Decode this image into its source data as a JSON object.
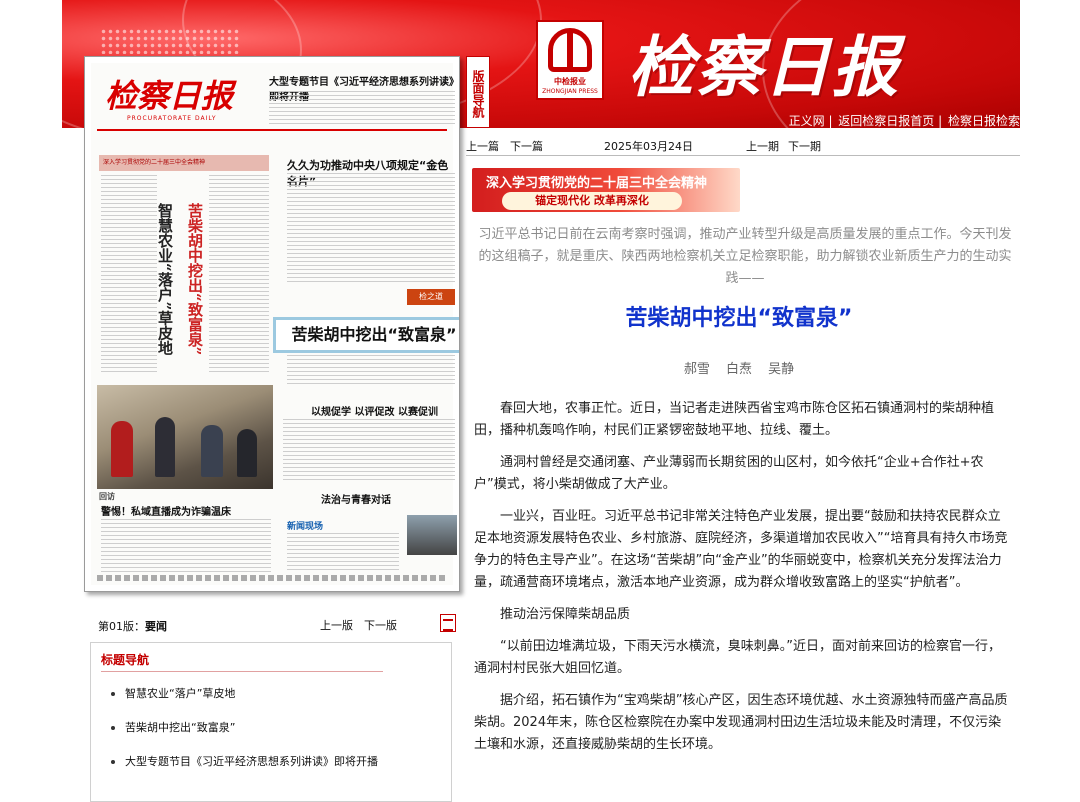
{
  "header": {
    "masthead": "检察日报",
    "logo_caption": "中检报业",
    "logo_caption_en": "ZHONGJIAN PRESS",
    "links": [
      "正义网",
      "返回检察日报首页",
      "检察日报检索"
    ]
  },
  "side_tab": "版面导航",
  "thumbnail": {
    "masthead": "检察日报",
    "subtitle": "PROCURATORATE DAILY",
    "top_headline": "大型专题节目《习近平经济思想系列讲读》即将开播",
    "banner": "深入学习贯彻党的二十届三中全会精神",
    "headline_right": "久久为功推动中央八项规定“金色名片”",
    "vertical_1": "苦柴胡中挖出“致富泉”",
    "vertical_2": "智慧农业“落户”草皮地",
    "highlight": "苦柴胡中挖出“致富泉”",
    "seal": "检之道",
    "h_mid": "以规促学 以评促改 以赛促训",
    "h_left": "警惕！私域直播成为诈骗温床",
    "h_right": "法治与青春对话",
    "h_news": "新闻现场",
    "caption": "回访"
  },
  "nav": {
    "prev_article": "上一篇",
    "next_article": "下一篇",
    "date": "2025年03月24日",
    "prev_issue": "上一期",
    "next_issue": "下一期"
  },
  "promo": {
    "line1": "深入学习贯彻党的二十届三中全会精神",
    "line2": "锚定现代化 改革再深化"
  },
  "article": {
    "lead": "习近平总书记日前在云南考察时强调，推动产业转型升级是高质量发展的重点工作。今天刊发的这组稿子，就是重庆、陕西两地检察机关立足检察职能，助力解锁农业新质生产力的生动实践——",
    "title": "苦柴胡中挖出“致富泉”",
    "authors": [
      "郝雪",
      "白焘",
      "吴静"
    ],
    "paragraphs": [
      "春回大地，农事正忙。近日，当记者走进陕西省宝鸡市陈仓区拓石镇通洞村的柴胡种植田，播种机轰鸣作响，村民们正紧锣密鼓地平地、拉线、覆土。",
      "通洞村曾经是交通闭塞、产业薄弱而长期贫困的山区村，如今依托“企业+合作社+农户”模式，将小柴胡做成了大产业。",
      "一业兴，百业旺。习近平总书记非常关注特色产业发展，提出要“鼓励和扶持农民群众立足本地资源发展特色农业、乡村旅游、庭院经济，多渠道增加农民收入”“培育具有持久市场竞争力的特色主导产业”。在这场“苦柴胡”向“金产业”的华丽蜕变中，检察机关充分发挥法治力量，疏通营商环境堵点，激活本地产业资源，成为群众增收致富路上的坚实“护航者”。",
      "推动治污保障柴胡品质",
      "“以前田边堆满垃圾，下雨天污水横流，臭味刺鼻。”近日，面对前来回访的检察官一行，通洞村村民张大姐回忆道。",
      "据介绍，拓石镇作为“宝鸡柴胡”核心产区，因生态环境优越、水土资源独特而盛产高品质柴胡。2024年末，陈仓区检察院在办案中发现通洞村田边生活垃圾未能及时清理，不仅污染土壤和水源，还直接威胁柴胡的生长环境。"
    ]
  },
  "page_bar": {
    "label_prefix": "第01版：",
    "label_name": "要闻",
    "prev": "上一版",
    "next": "下一版"
  },
  "toc": {
    "heading": "标题导航",
    "items": [
      "智慧农业“落户”草皮地",
      "苦柴胡中挖出“致富泉”",
      "大型专题节目《习近平经济思想系列讲读》即将开播"
    ]
  },
  "colors": {
    "brand_red": "#c40000",
    "title_blue": "#1133cc",
    "lead_gray": "#8c8c8c"
  }
}
